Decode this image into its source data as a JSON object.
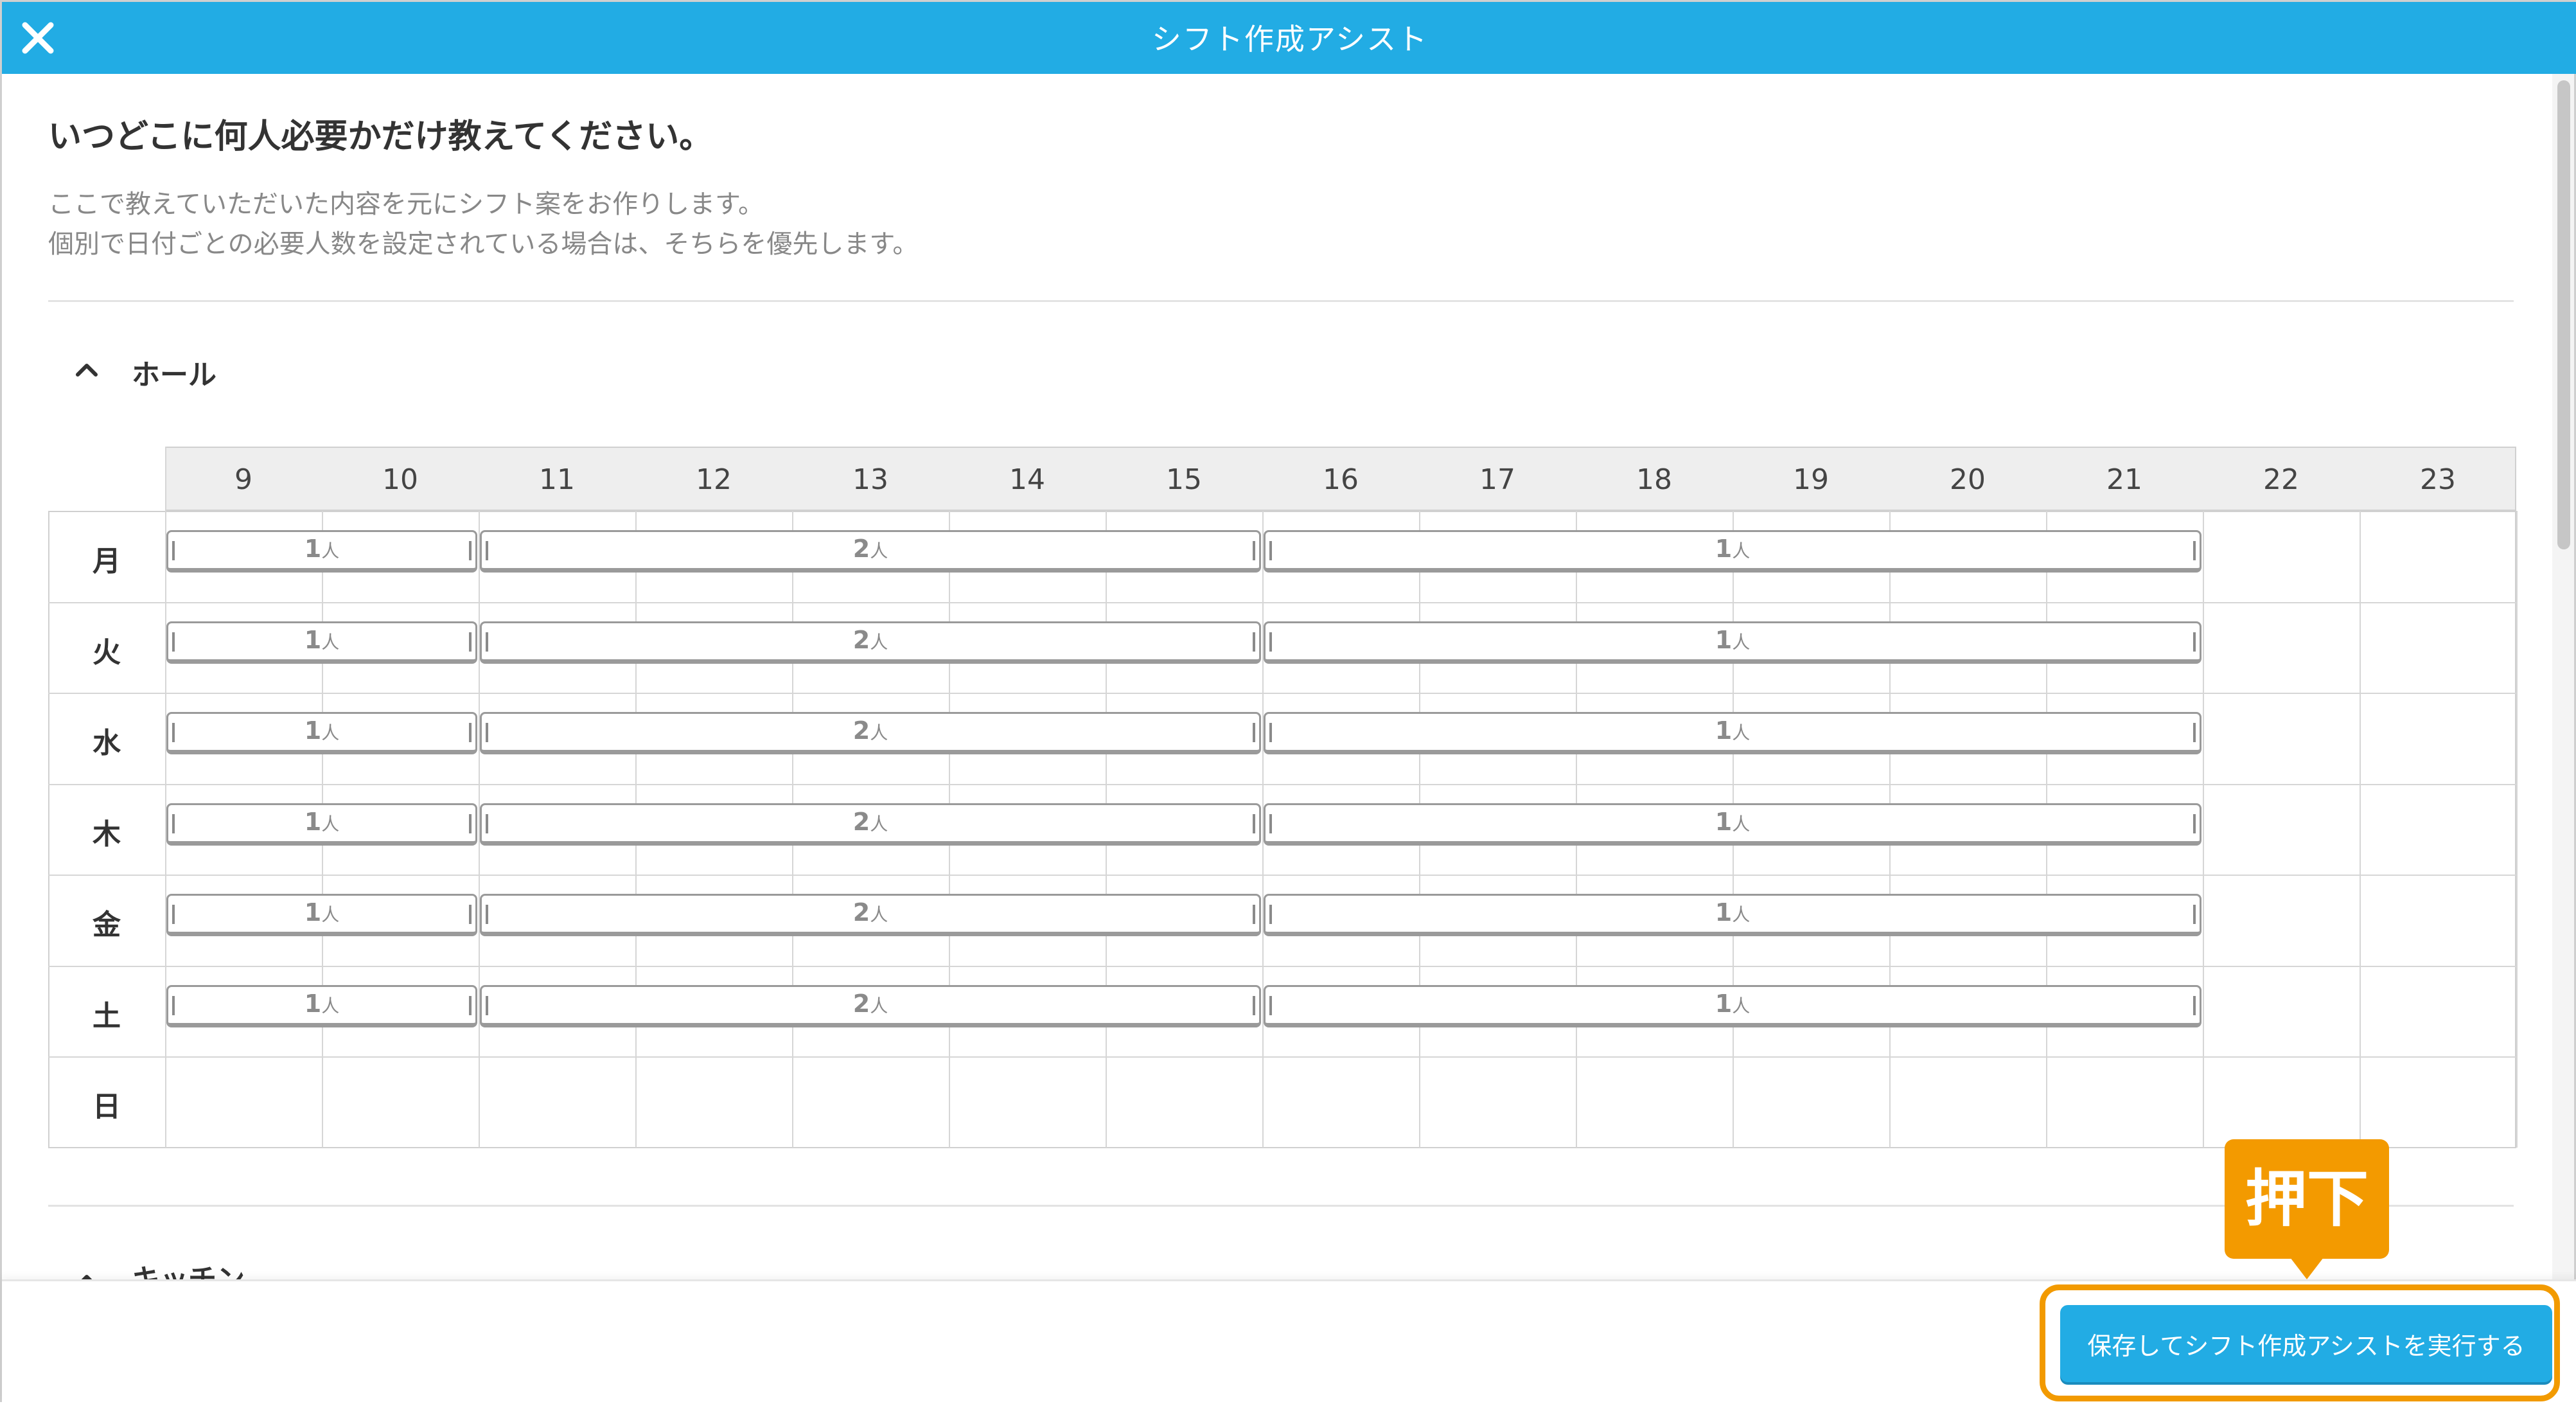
{
  "window": {
    "title": "シフト作成アシスト"
  },
  "intro": {
    "headline": "いつどこに何人必要かだけ教えてください。",
    "desc1": "ここで教えていただいた内容を元にシフト案をお作りします。",
    "desc2": "個別で日付ごとの必要人数を設定されている場合は、そちらを優先します。"
  },
  "section1": {
    "label": "ホール",
    "state": "expanded"
  },
  "section2": {
    "label": "キッチン"
  },
  "grid": {
    "hours": [
      "9",
      "10",
      "11",
      "12",
      "13",
      "14",
      "15",
      "16",
      "17",
      "18",
      "19",
      "20",
      "21",
      "22",
      "23"
    ],
    "days": [
      "月",
      "火",
      "水",
      "木",
      "金",
      "土",
      "日"
    ],
    "unit": "人",
    "rows": [
      {
        "day": "月",
        "segments": [
          {
            "start": 9,
            "end": 11,
            "count": "1"
          },
          {
            "start": 11,
            "end": 16,
            "count": "2"
          },
          {
            "start": 16,
            "end": 22,
            "count": "1"
          }
        ]
      },
      {
        "day": "火",
        "segments": [
          {
            "start": 9,
            "end": 11,
            "count": "1"
          },
          {
            "start": 11,
            "end": 16,
            "count": "2"
          },
          {
            "start": 16,
            "end": 22,
            "count": "1"
          }
        ]
      },
      {
        "day": "水",
        "segments": [
          {
            "start": 9,
            "end": 11,
            "count": "1"
          },
          {
            "start": 11,
            "end": 16,
            "count": "2"
          },
          {
            "start": 16,
            "end": 22,
            "count": "1"
          }
        ]
      },
      {
        "day": "木",
        "segments": [
          {
            "start": 9,
            "end": 11,
            "count": "1"
          },
          {
            "start": 11,
            "end": 16,
            "count": "2"
          },
          {
            "start": 16,
            "end": 22,
            "count": "1"
          }
        ]
      },
      {
        "day": "金",
        "segments": [
          {
            "start": 9,
            "end": 11,
            "count": "1"
          },
          {
            "start": 11,
            "end": 16,
            "count": "2"
          },
          {
            "start": 16,
            "end": 22,
            "count": "1"
          }
        ]
      },
      {
        "day": "土",
        "segments": [
          {
            "start": 9,
            "end": 11,
            "count": "1"
          },
          {
            "start": 11,
            "end": 16,
            "count": "2"
          },
          {
            "start": 16,
            "end": 22,
            "count": "1"
          }
        ]
      },
      {
        "day": "日",
        "segments": []
      }
    ]
  },
  "footer": {
    "submit_label": "保存してシフト作成アシストを実行する"
  },
  "annotation": {
    "callout_label": "押下"
  },
  "colors": {
    "header": "#22ace4",
    "accent": "#f39a00",
    "bar_border": "#9a9a9a"
  },
  "icons": {
    "close": "close-icon",
    "collapse": "chevron-up-icon"
  }
}
